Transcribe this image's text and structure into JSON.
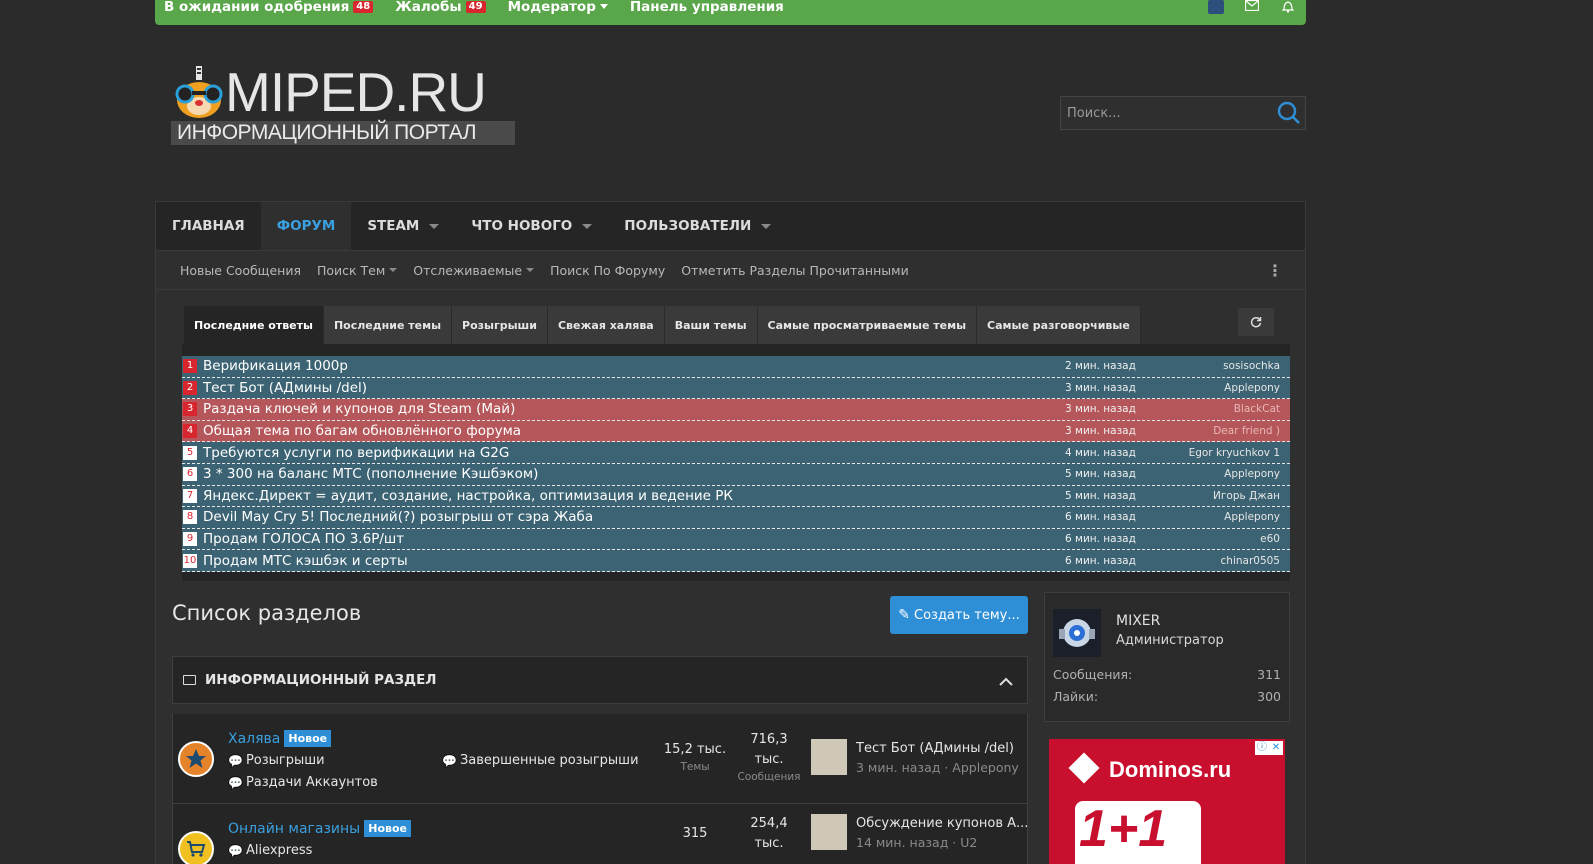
{
  "staffbar": {
    "items": [
      {
        "label": "В ожидании одобрения",
        "badge": "48"
      },
      {
        "label": "Жалобы",
        "badge": "49"
      },
      {
        "label": "Модератор"
      },
      {
        "label": "Панель управления"
      }
    ],
    "icons": [
      "avatar-icon",
      "mail-icon",
      "bell-icon"
    ]
  },
  "header": {
    "logo_text": "MIPED.RU",
    "logo_subtitle": "ИНФОРМАЦИОННЫЙ ПОРТАЛ",
    "search_placeholder": "Поиск..."
  },
  "nav": {
    "tabs": [
      {
        "label": "ГЛАВНАЯ"
      },
      {
        "label": "ФОРУМ",
        "active": true
      },
      {
        "label": "STEAM"
      },
      {
        "label": "ЧТО НОВОГО"
      },
      {
        "label": "ПОЛЬЗОВАТЕЛИ"
      }
    ],
    "subnav": [
      {
        "label": "Новые Сообщения"
      },
      {
        "label": "Поиск Тем"
      },
      {
        "label": "Отслеживаемые"
      },
      {
        "label": "Поиск По Форуму"
      },
      {
        "label": "Отметить Разделы Прочитанными"
      }
    ]
  },
  "thread_tabs": [
    "Последние ответы",
    "Последние темы",
    "Розыгрыши",
    "Свежая халява",
    "Ваши темы",
    "Самые просматриваемые темы",
    "Самые разговорчивые"
  ],
  "threads": [
    {
      "num": "1",
      "title": "Верификация 1000р",
      "time": "2 мин. назад",
      "user": "sosisochka",
      "style": "blue"
    },
    {
      "num": "2",
      "title": "Тест Бот (АДмины /del)",
      "time": "3 мин. назад",
      "user": "Applepony",
      "style": "blue"
    },
    {
      "num": "3",
      "title": "Раздача ключей и купонов для Steam (Май)",
      "time": "3 мин. назад",
      "user": "BlackCat",
      "style": "red"
    },
    {
      "num": "4",
      "title": "Общая тема по багам обновлённого форума",
      "time": "3 мин. назад",
      "user": "Dear friend )",
      "style": "red"
    },
    {
      "num": "5",
      "title": "Требуются услуги по верификации на G2G",
      "time": "4 мин. назад",
      "user": "Egor kryuchkov 1",
      "style": "blue"
    },
    {
      "num": "6",
      "title": "3 * 300 на баланс МТС (пополнение Кэшбэком)",
      "time": "5 мин. назад",
      "user": "Applepony",
      "style": "blue"
    },
    {
      "num": "7",
      "title": "Яндекс.Директ = аудит, создание, настройка, оптимизация и ведение РК",
      "time": "5 мин. назад",
      "user": "Игорь Джан",
      "style": "blue"
    },
    {
      "num": "8",
      "title": "Devil May Cry 5! Последний(?) розыгрыш от сэра Жаба",
      "time": "6 мин. назад",
      "user": "Applepony",
      "style": "blue"
    },
    {
      "num": "9",
      "title": "Продам ГОЛОСА ПО 3.6Р/шт",
      "time": "6 мин. назад",
      "user": "e60",
      "style": "blue"
    },
    {
      "num": "10",
      "title": "Продам МТС кэшбэк и серты",
      "time": "6 мин. назад",
      "user": "chinar0505",
      "style": "blue"
    }
  ],
  "forum": {
    "title": "Список разделов",
    "create_label": "Создать тему...",
    "category": "ИНФОРМАЦИОННЫЙ РАЗДЕЛ",
    "rows": [
      {
        "title": "Халява",
        "badge": "Новое",
        "subs": [
          "Розыгрыши",
          "Раздачи Аккаунтов",
          "Завершенные розыгрыши"
        ],
        "threads": "15,2 тыс.",
        "threads_label": "Темы",
        "posts": "716,3 тыс.",
        "posts_label": "Сообщения",
        "last_title": "Тест Бот (АДмины /del)",
        "last_meta": "3 мин. назад · Applepony"
      },
      {
        "title": "Онлайн магазины",
        "badge": "Новое",
        "subs": [
          "Aliexpress"
        ],
        "threads": "315",
        "threads_label": "",
        "posts": "254,4 тыс.",
        "posts_label": "",
        "last_title": "Обсуждение купонов А...",
        "last_meta": "14 мин. назад · U2"
      }
    ]
  },
  "userbox": {
    "name": "MIXER",
    "role": "Администратор",
    "stats": [
      {
        "label": "Сообщения:",
        "value": "311"
      },
      {
        "label": "Лайки:",
        "value": "300"
      }
    ]
  },
  "ad": {
    "brand": "Dominos.ru",
    "promo": "1+1"
  },
  "colors": {
    "accent": "#3aa0e0",
    "staffbar": "#5aa64a",
    "row_blue": "#3b6373",
    "row_red": "#b5575a",
    "badge_red": "#d8262f"
  }
}
